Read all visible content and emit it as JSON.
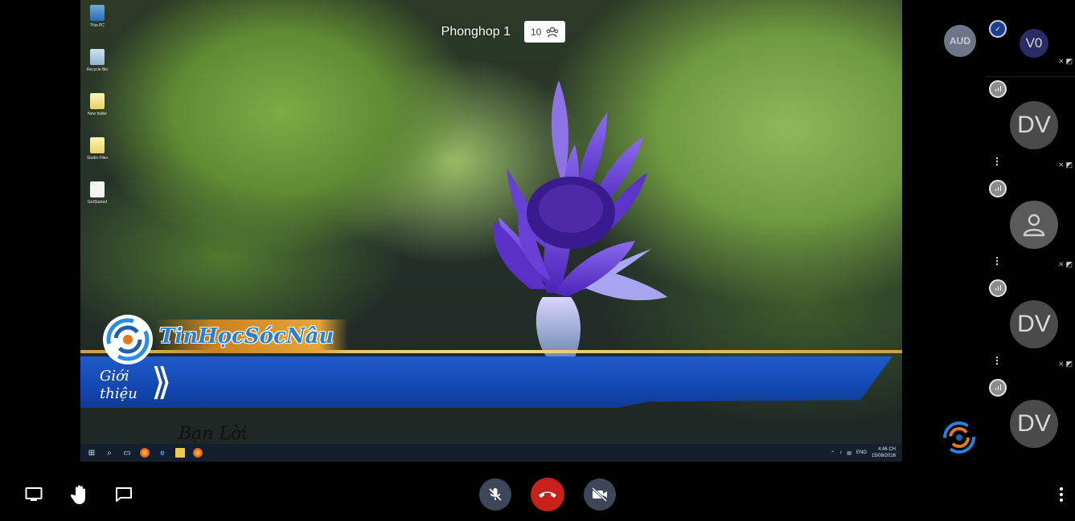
{
  "stage": {
    "room_title": "Phonghop 1",
    "participant_count": "10",
    "lower_third": {
      "brand": "TinHọcSócNâu",
      "band_line1": "Giới",
      "band_line2": "thiệu",
      "signature": "Bạn Lời"
    },
    "taskbar": {
      "tray_lang": "ENG",
      "clock_time": "4:46 CH",
      "clock_date": "15/08/2016"
    },
    "desktop_icons": [
      {
        "label": "This PC",
        "icon": "computer-icon"
      },
      {
        "label": "Recycle Bin",
        "icon": "recycle-bin-icon"
      },
      {
        "label": "New folder",
        "icon": "folder-icon"
      },
      {
        "label": "Studio Files",
        "icon": "folder-icon"
      },
      {
        "label": "GetStarted",
        "icon": "document-icon"
      }
    ]
  },
  "participants": {
    "audio_only_badge": "AUD",
    "tiles": [
      {
        "initials": "V0",
        "style": "active-speaker"
      },
      {
        "initials": "DV",
        "style": "default"
      },
      {
        "initials": "",
        "style": "placeholder"
      },
      {
        "initials": "DV",
        "style": "default"
      },
      {
        "initials": "DV",
        "style": "default"
      }
    ]
  },
  "toolbar": {
    "left": [
      "screen-share-icon",
      "raise-hand-icon",
      "chat-icon"
    ],
    "center": [
      "mic-muted-icon",
      "hangup-icon",
      "camera-off-icon"
    ],
    "right": [
      "more-vertical-icon"
    ]
  },
  "colors": {
    "hangup": "#c8201a",
    "control_button": "#3d4759",
    "avatar": "#4a4a4a",
    "active_avatar": "#2a2b67",
    "band_blue": "#1447b2"
  }
}
